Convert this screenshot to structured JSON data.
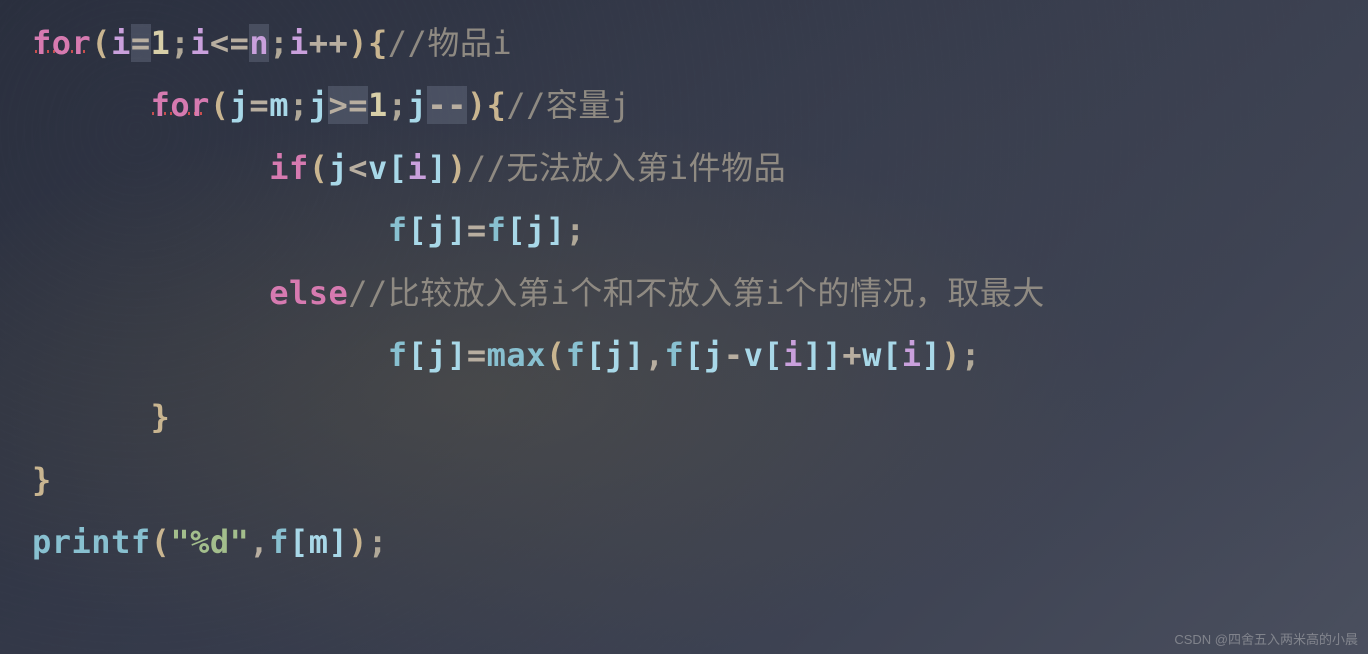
{
  "code": {
    "keywords": {
      "for1": "for",
      "for2": "for",
      "if": "if",
      "else": "else",
      "printf": "printf"
    },
    "vars": {
      "i": "i",
      "j": "j",
      "n": "n",
      "m": "m",
      "f": "f",
      "v": "v",
      "w": "w"
    },
    "nums": {
      "one1": "1",
      "one2": "1"
    },
    "ops": {
      "eq1": "=",
      "le": "<=",
      "inc": "++",
      "eq2": "=",
      "ge": ">=",
      "dec": "--",
      "lt": "<",
      "eq3": "=",
      "eq4": "=",
      "comma": ",",
      "minus": "-",
      "plus": "+"
    },
    "func": {
      "max": "max"
    },
    "str": {
      "fmt": "\"%d\""
    },
    "comments": {
      "c1": "//物品i",
      "c2": "//容量j",
      "c3_pre": "//无法放入第",
      "c3_mid": "i",
      "c3_post": "件物品",
      "c4_pre": "//比较放入第",
      "c4_mid1": "i",
      "c4_mid2": "个和不放入第",
      "c4_mid3": "i",
      "c4_post": "个的情况，取最大"
    }
  },
  "watermark": "CSDN @四舍五入两米高的小晨"
}
